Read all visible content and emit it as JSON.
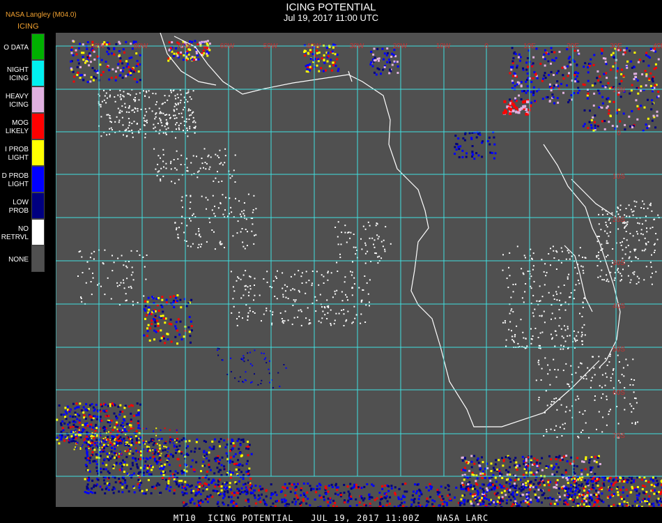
{
  "header": {
    "title": "ICING POTENTIAL",
    "subtitle": "Jul 19, 2017 11:00 UTC",
    "provider": "NASA Langley (M04.0)",
    "product": "ICING"
  },
  "legend": {
    "items": [
      {
        "label": "O DATA",
        "color": "#00b000"
      },
      {
        "label": "NIGHT\nICING",
        "color": "#00f0f0"
      },
      {
        "label": "HEAVY\nICING",
        "color": "#e0b0e0"
      },
      {
        "label": "MOG\nLIKELY",
        "color": "#ff0000"
      },
      {
        "label": "I PROB\nLIGHT",
        "color": "#ffff00"
      },
      {
        "label": "D PROB\nLIGHT",
        "color": "#0000ff"
      },
      {
        "label": "LOW\nPROB",
        "color": "#000080"
      },
      {
        "label": "NO\nRETRVL",
        "color": "#ffffff"
      },
      {
        "label": "NONE",
        "color": "#505050"
      }
    ]
  },
  "map": {
    "background": "#505050",
    "grid_color": "#40e0e0",
    "coast_color": "#ffffff",
    "label_color": "#c83030",
    "top_labels": [
      "90W",
      "80W",
      "70W",
      "60W",
      "50W",
      "40W",
      "30W",
      "20W",
      "10W",
      "0",
      "10E",
      "20E",
      "30E",
      "40E"
    ],
    "right_labels": [
      "10N",
      "0",
      "10S",
      "20S",
      "30S",
      "40S",
      "50S",
      "60S",
      "70S"
    ]
  },
  "footer": {
    "text": "MT10  ICING POTENTIAL   JUL 19, 2017 11:00Z   NASA LARC"
  }
}
